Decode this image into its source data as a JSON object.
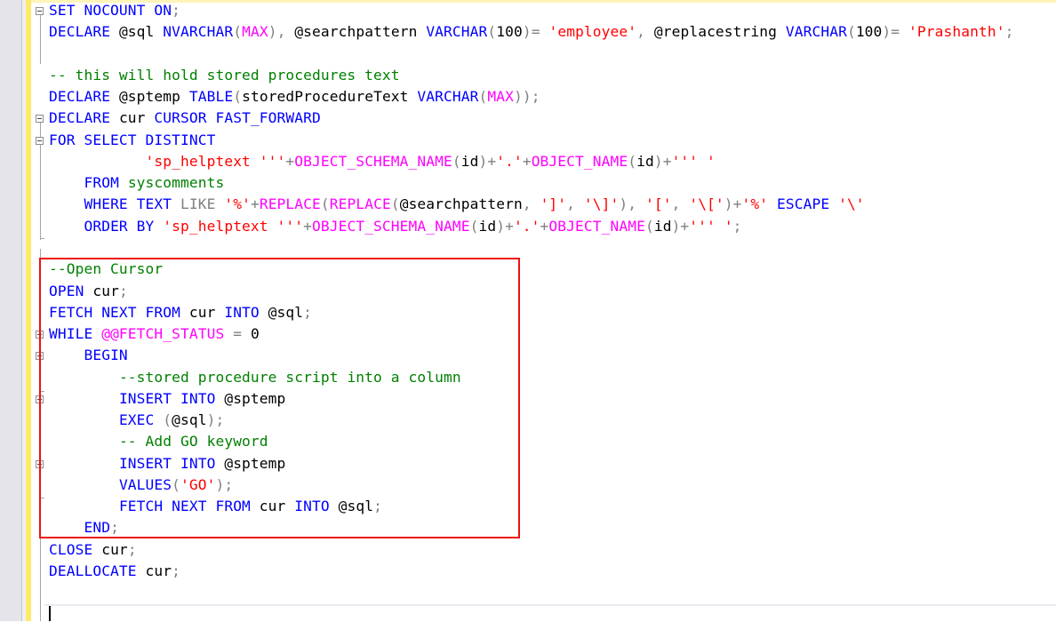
{
  "editor": {
    "language": "T-SQL",
    "highlight_box": {
      "color": "#ee1111",
      "from_line": 13,
      "to_line": 25
    },
    "colors": {
      "keyword": "#0000ff",
      "function": "#ff00ff",
      "string": "#ff0000",
      "comment": "#008000",
      "operator": "#808080",
      "identifier": "#000000"
    },
    "lines": [
      [
        [
          "kw",
          "SET NOCOUNT ON"
        ],
        [
          "op",
          ";"
        ]
      ],
      [
        [
          "kw",
          "DECLARE "
        ],
        [
          "id",
          "@sql "
        ],
        [
          "kw",
          "NVARCHAR"
        ],
        [
          "op",
          "("
        ],
        [
          "fn",
          "MAX"
        ],
        [
          "op",
          "), "
        ],
        [
          "id",
          "@searchpattern "
        ],
        [
          "kw",
          "VARCHAR"
        ],
        [
          "op",
          "("
        ],
        [
          "id",
          "100"
        ],
        [
          "op",
          ")= "
        ],
        [
          "str",
          "'employee'"
        ],
        [
          "op",
          ", "
        ],
        [
          "id",
          "@replacestring "
        ],
        [
          "kw",
          "VARCHAR"
        ],
        [
          "op",
          "("
        ],
        [
          "id",
          "100"
        ],
        [
          "op",
          ")= "
        ],
        [
          "str",
          "'Prashanth'"
        ],
        [
          "op",
          ";"
        ]
      ],
      [],
      [
        [
          "cm",
          "-- this will hold stored procedures text"
        ]
      ],
      [
        [
          "kw",
          "DECLARE "
        ],
        [
          "id",
          "@sptemp "
        ],
        [
          "kw",
          "TABLE"
        ],
        [
          "op",
          "("
        ],
        [
          "id",
          "storedProcedureText "
        ],
        [
          "kw",
          "VARCHAR"
        ],
        [
          "op",
          "("
        ],
        [
          "fn",
          "MAX"
        ],
        [
          "op",
          "));"
        ]
      ],
      [
        [
          "kw",
          "DECLARE "
        ],
        [
          "id",
          "cur "
        ],
        [
          "kw",
          "CURSOR FAST_FORWARD"
        ]
      ],
      [
        [
          "kw",
          "FOR SELECT DISTINCT"
        ]
      ],
      [
        [
          "id",
          "           "
        ],
        [
          "str",
          "'sp_helptext '''"
        ],
        [
          "op",
          "+"
        ],
        [
          "fn",
          "OBJECT_SCHEMA_NAME"
        ],
        [
          "op",
          "("
        ],
        [
          "id",
          "id"
        ],
        [
          "op",
          ")+"
        ],
        [
          "str",
          "'.'"
        ],
        [
          "op",
          "+"
        ],
        [
          "fn",
          "OBJECT_NAME"
        ],
        [
          "op",
          "("
        ],
        [
          "id",
          "id"
        ],
        [
          "op",
          ")+"
        ],
        [
          "str",
          "''' '"
        ]
      ],
      [
        [
          "id",
          "    "
        ],
        [
          "kw",
          "FROM "
        ],
        [
          "sys",
          "syscomments"
        ]
      ],
      [
        [
          "id",
          "    "
        ],
        [
          "kw",
          "WHERE TEXT "
        ],
        [
          "op",
          "LIKE "
        ],
        [
          "str",
          "'%'"
        ],
        [
          "op",
          "+"
        ],
        [
          "fn",
          "REPLACE"
        ],
        [
          "op",
          "("
        ],
        [
          "fn",
          "REPLACE"
        ],
        [
          "op",
          "("
        ],
        [
          "id",
          "@searchpattern"
        ],
        [
          "op",
          ", "
        ],
        [
          "str",
          "']'"
        ],
        [
          "op",
          ", "
        ],
        [
          "str",
          "'\\]'"
        ],
        [
          "op",
          "), "
        ],
        [
          "str",
          "'['"
        ],
        [
          "op",
          ", "
        ],
        [
          "str",
          "'\\['"
        ],
        [
          "op",
          ")+"
        ],
        [
          "str",
          "'%'"
        ],
        [
          "id",
          " "
        ],
        [
          "kw",
          "ESCAPE "
        ],
        [
          "str",
          "'\\'"
        ]
      ],
      [
        [
          "id",
          "    "
        ],
        [
          "kw",
          "ORDER BY "
        ],
        [
          "str",
          "'sp_helptext '''"
        ],
        [
          "op",
          "+"
        ],
        [
          "fn",
          "OBJECT_SCHEMA_NAME"
        ],
        [
          "op",
          "("
        ],
        [
          "id",
          "id"
        ],
        [
          "op",
          ")+"
        ],
        [
          "str",
          "'.'"
        ],
        [
          "op",
          "+"
        ],
        [
          "fn",
          "OBJECT_NAME"
        ],
        [
          "op",
          "("
        ],
        [
          "id",
          "id"
        ],
        [
          "op",
          ")+"
        ],
        [
          "str",
          "''' '"
        ],
        [
          "op",
          ";"
        ]
      ],
      [],
      [
        [
          "cm",
          "--Open Cursor"
        ]
      ],
      [
        [
          "kw",
          "OPEN "
        ],
        [
          "id",
          "cur"
        ],
        [
          "op",
          ";"
        ]
      ],
      [
        [
          "kw",
          "FETCH NEXT FROM "
        ],
        [
          "id",
          "cur "
        ],
        [
          "kw",
          "INTO "
        ],
        [
          "id",
          "@sql"
        ],
        [
          "op",
          ";"
        ]
      ],
      [
        [
          "kw",
          "WHILE "
        ],
        [
          "fn",
          "@@FETCH_STATUS "
        ],
        [
          "op",
          "= "
        ],
        [
          "id",
          "0"
        ]
      ],
      [
        [
          "id",
          "    "
        ],
        [
          "kw",
          "BEGIN"
        ]
      ],
      [
        [
          "id",
          "        "
        ],
        [
          "cm",
          "--stored procedure script into a column"
        ]
      ],
      [
        [
          "id",
          "        "
        ],
        [
          "kw",
          "INSERT INTO "
        ],
        [
          "id",
          "@sptemp"
        ]
      ],
      [
        [
          "id",
          "        "
        ],
        [
          "kw",
          "EXEC "
        ],
        [
          "op",
          "("
        ],
        [
          "id",
          "@sql"
        ],
        [
          "op",
          ");"
        ]
      ],
      [
        [
          "id",
          "        "
        ],
        [
          "cm",
          "-- Add GO keyword"
        ]
      ],
      [
        [
          "id",
          "        "
        ],
        [
          "kw",
          "INSERT INTO "
        ],
        [
          "id",
          "@sptemp"
        ]
      ],
      [
        [
          "id",
          "        "
        ],
        [
          "kw",
          "VALUES"
        ],
        [
          "op",
          "("
        ],
        [
          "str",
          "'GO'"
        ],
        [
          "op",
          ");"
        ]
      ],
      [
        [
          "id",
          "        "
        ],
        [
          "kw",
          "FETCH NEXT FROM "
        ],
        [
          "id",
          "cur "
        ],
        [
          "kw",
          "INTO "
        ],
        [
          "id",
          "@sql"
        ],
        [
          "op",
          ";"
        ]
      ],
      [
        [
          "id",
          "    "
        ],
        [
          "kw",
          "END"
        ],
        [
          "op",
          ";"
        ]
      ],
      [
        [
          "kw",
          "CLOSE "
        ],
        [
          "id",
          "cur"
        ],
        [
          "op",
          ";"
        ]
      ],
      [
        [
          "kw",
          "DEALLOCATE "
        ],
        [
          "id",
          "cur"
        ],
        [
          "op",
          ";"
        ]
      ],
      [],
      []
    ],
    "fold_markers": [
      0,
      5,
      6,
      15,
      16,
      18,
      21
    ]
  }
}
